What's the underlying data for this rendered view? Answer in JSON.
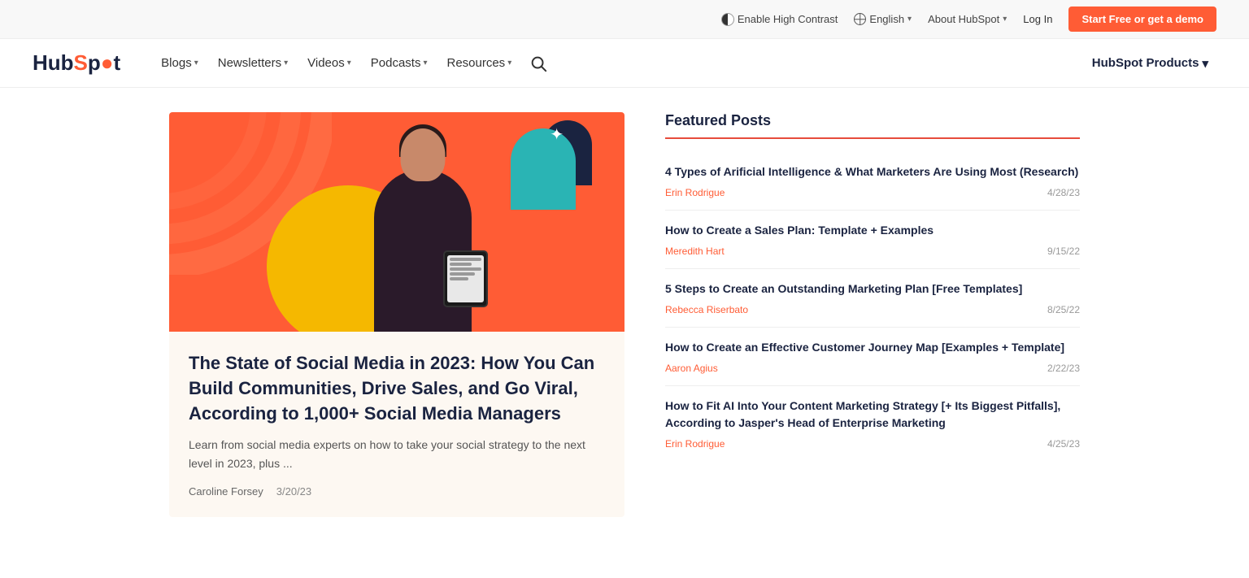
{
  "topbar": {
    "contrast_label": "Enable High Contrast",
    "language_label": "English",
    "about_label": "About HubSpot",
    "login_label": "Log In",
    "cta_label": "Start Free or get a demo"
  },
  "nav": {
    "logo": "HubSpot",
    "items": [
      {
        "label": "Blogs"
      },
      {
        "label": "Newsletters"
      },
      {
        "label": "Videos"
      },
      {
        "label": "Podcasts"
      },
      {
        "label": "Resources"
      }
    ],
    "products_label": "HubSpot Products"
  },
  "featured_article": {
    "title": "The State of Social Media in 2023: How You Can Build Communities, Drive Sales, and Go Viral, According to 1,000+ Social Media Managers",
    "excerpt": "Learn from social media experts on how to take your social strategy to the next level in 2023, plus ...",
    "author": "Caroline Forsey",
    "date": "3/20/23"
  },
  "featured_posts": {
    "section_title": "Featured Posts",
    "posts": [
      {
        "title": "4 Types of Arificial Intelligence & What Marketers Are Using Most (Research)",
        "author": "Erin Rodrigue",
        "date": "4/28/23"
      },
      {
        "title": "How to Create a Sales Plan: Template + Examples",
        "author": "Meredith Hart",
        "date": "9/15/22"
      },
      {
        "title": "5 Steps to Create an Outstanding Marketing Plan [Free Templates]",
        "author": "Rebecca Riserbato",
        "date": "8/25/22"
      },
      {
        "title": "How to Create an Effective Customer Journey Map [Examples + Template]",
        "author": "Aaron Agius",
        "date": "2/22/23"
      },
      {
        "title": "How to Fit AI Into Your Content Marketing Strategy [+ Its Biggest Pitfalls], According to Jasper's Head of Enterprise Marketing",
        "author": "Erin Rodrigue",
        "date": "4/25/23"
      }
    ]
  }
}
